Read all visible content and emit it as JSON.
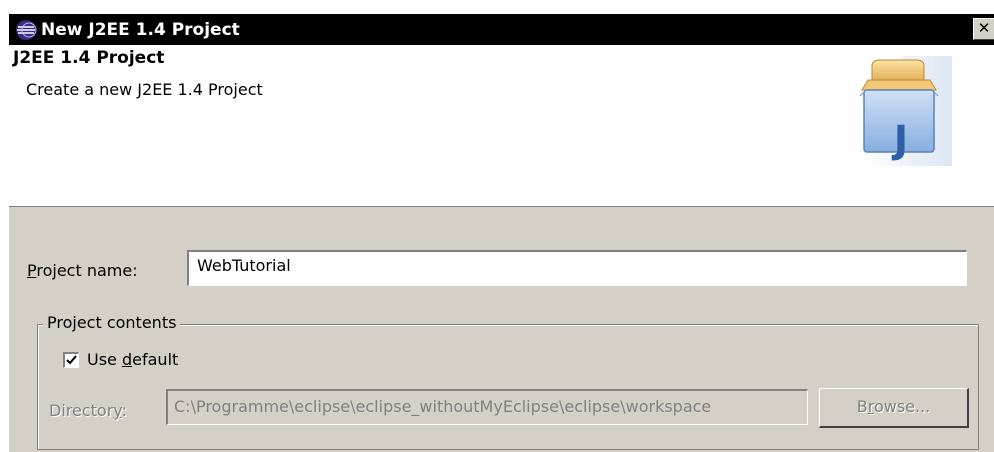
{
  "window": {
    "title": "New J2EE 1.4 Project",
    "close_symbol": "✕"
  },
  "banner": {
    "title": "J2EE 1.4 Project",
    "description": "Create a new J2EE 1.4 Project",
    "icon": "j2ee-project-wizard-icon",
    "icon_letter": "J"
  },
  "form": {
    "project_name_label": {
      "mnemonic": "P",
      "rest": "roject name:"
    },
    "project_name_value": "WebTutorial",
    "contents_group_label": "Project contents",
    "use_default": {
      "checked": true,
      "pre": "Use ",
      "mnemonic": "d",
      "rest": "efault"
    },
    "directory_label": {
      "pre": "Director",
      "mnemonic": "y",
      "rest": ":"
    },
    "directory_value": "C:\\Programme\\eclipse\\eclipse_withoutMyEclipse\\eclipse\\workspace",
    "browse_button": {
      "pre": "B",
      "mnemonic": "r",
      "rest": "owse..."
    }
  }
}
